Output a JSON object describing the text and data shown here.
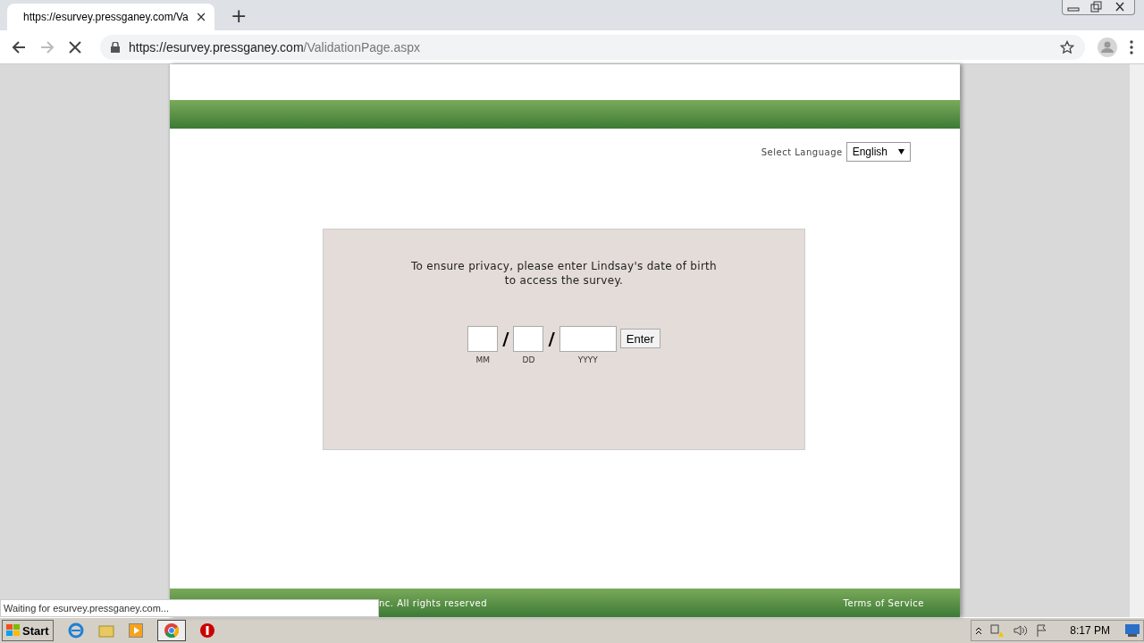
{
  "browser": {
    "tab": {
      "title": "https://esurvey.pressganey.com/Va",
      "close": "×"
    },
    "new_tab": "+",
    "url": {
      "host": "https://esurvey.pressganey.com",
      "path": "/ValidationPage.aspx"
    }
  },
  "page": {
    "language": {
      "label": "Select Language",
      "value": "English"
    },
    "prompt": {
      "line1": "To ensure privacy, please enter Lindsay's date of birth",
      "line2": "to access the survey."
    },
    "dob_fields": [
      {
        "caption": "MM",
        "kind": "short"
      },
      {
        "caption": "DD",
        "kind": "short"
      },
      {
        "caption": "YYYY",
        "kind": "long"
      }
    ],
    "separator": "/",
    "enter_button": "Enter",
    "footer": {
      "copyright": "nc. All rights reserved",
      "terms": "Terms of Service"
    }
  },
  "status_text": "Waiting for esurvey.pressganey.com...",
  "taskbar": {
    "start": "Start",
    "clock": "8:17 PM"
  }
}
